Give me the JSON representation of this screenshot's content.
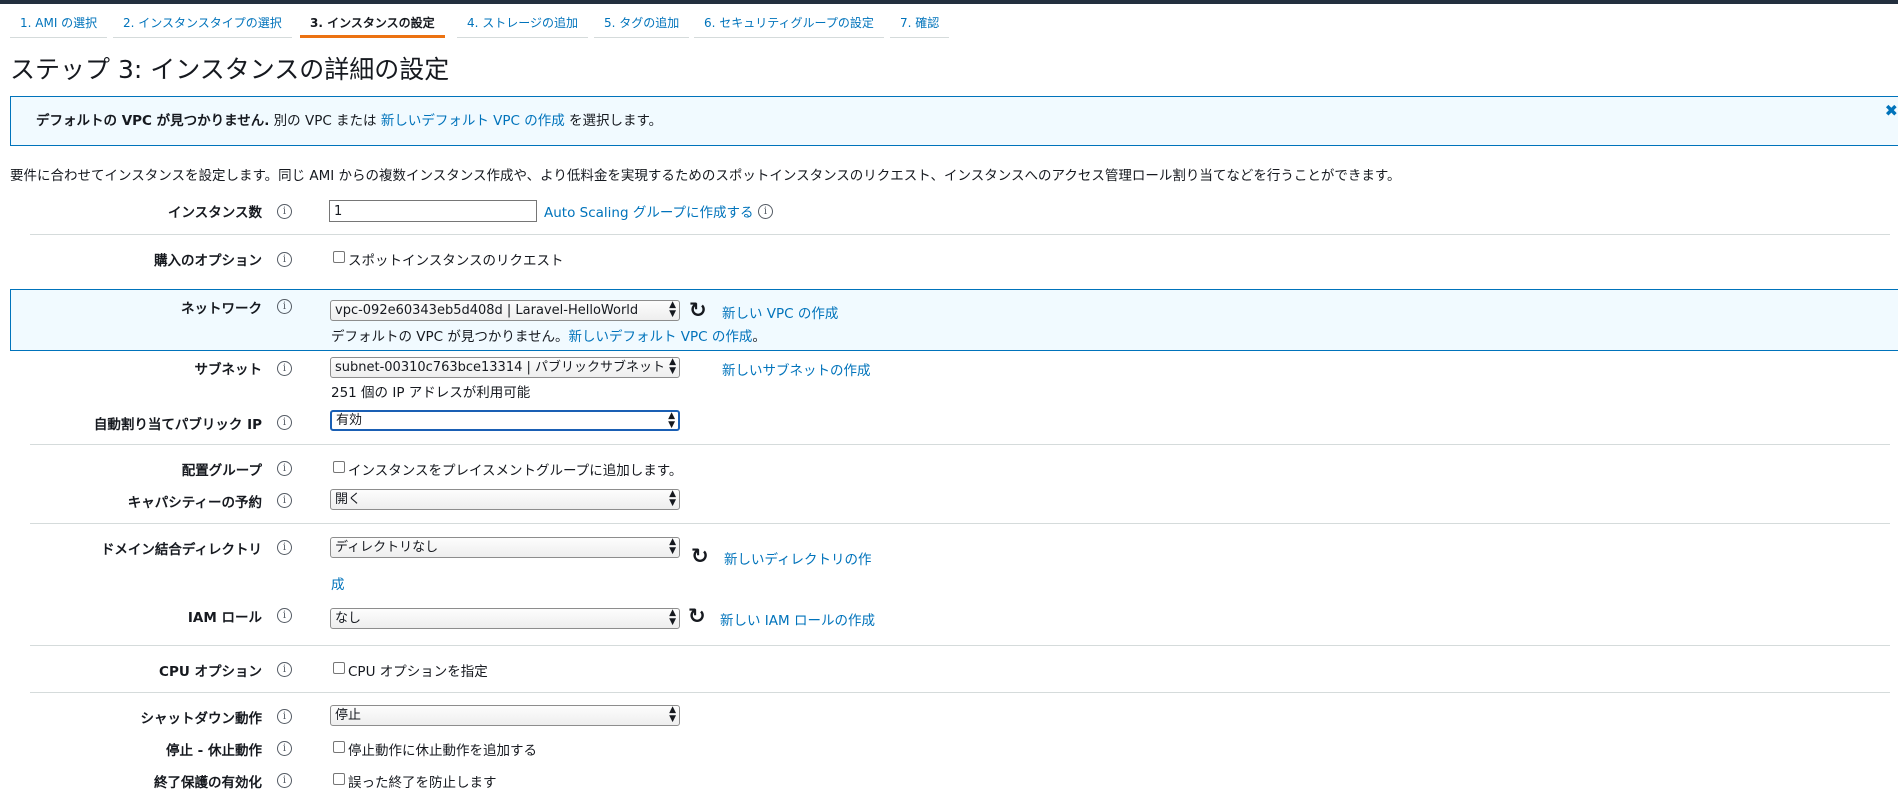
{
  "wizard_tabs": [
    {
      "label": "1. AMI の選択"
    },
    {
      "label": "2. インスタンスタイプの選択"
    },
    {
      "label": "3. インスタンスの設定",
      "active": true
    },
    {
      "label": "4. ストレージの追加"
    },
    {
      "label": "5. タグの追加"
    },
    {
      "label": "6. セキュリティグループの設定"
    },
    {
      "label": "7. 確認"
    }
  ],
  "page_title": "ステップ 3: インスタンスの詳細の設定",
  "banner": {
    "bold_text": "デフォルトの VPC が見つかりません.",
    "middle_text": " 別の VPC または ",
    "link_text": "新しいデフォルト VPC の作成",
    "end_text": " を選択します。",
    "close_glyph": "✖"
  },
  "description": "要件に合わせてインスタンスを設定します。同じ AMI からの複数インスタンス作成や、より低料金を実現するためのスポットインスタンスのリクエスト、インスタンスへのアクセス管理ロール割り当てなどを行うことができます。",
  "info_glyph": "i",
  "refresh_glyph": "↻",
  "select_arrow_up": "▲",
  "select_arrow_down": "▼",
  "form": {
    "instance_count": {
      "label": "インスタンス数",
      "value": "1",
      "link": "Auto Scaling グループに作成する"
    },
    "purchase_option": {
      "label": "購入のオプション",
      "checkbox": "スポットインスタンスのリクエスト"
    },
    "network": {
      "label": "ネットワーク",
      "value": "vpc-092e60343eb5d408d | Laravel-HelloWorld",
      "link": "新しい VPC の作成",
      "note_text": "デフォルトの VPC が見つかりません。",
      "note_link": "新しいデフォルト VPC の作成",
      "note_end": "。"
    },
    "subnet": {
      "label": "サブネット",
      "value": "subnet-00310c763bce13314 | パブリックサブネット",
      "link": "新しいサブネットの作成",
      "note": "251 個の IP アドレスが利用可能"
    },
    "public_ip": {
      "label": "自動割り当てパブリック IP",
      "value": "有効"
    },
    "placement_group": {
      "label": "配置グループ",
      "checkbox": "インスタンスをプレイスメントグループに追加します。"
    },
    "capacity": {
      "label": "キャパシティーの予約",
      "value": "開く"
    },
    "domain_dir": {
      "label": "ドメイン結合ディレクトリ",
      "value": "ディレクトリなし",
      "link_line1": "新しいディレクトリの作",
      "link_line2": "成"
    },
    "iam_role": {
      "label": "IAM ロール",
      "value": "なし",
      "link": "新しい IAM ロールの作成"
    },
    "cpu_options": {
      "label": "CPU オプション",
      "checkbox": "CPU オプションを指定"
    },
    "shutdown": {
      "label": "シャットダウン動作",
      "value": "停止"
    },
    "hibernate": {
      "label": "停止 - 休止動作",
      "checkbox": "停止動作に休止動作を追加する"
    },
    "termination": {
      "label": "終了保護の有効化",
      "checkbox": "誤った終了を防止します"
    }
  }
}
